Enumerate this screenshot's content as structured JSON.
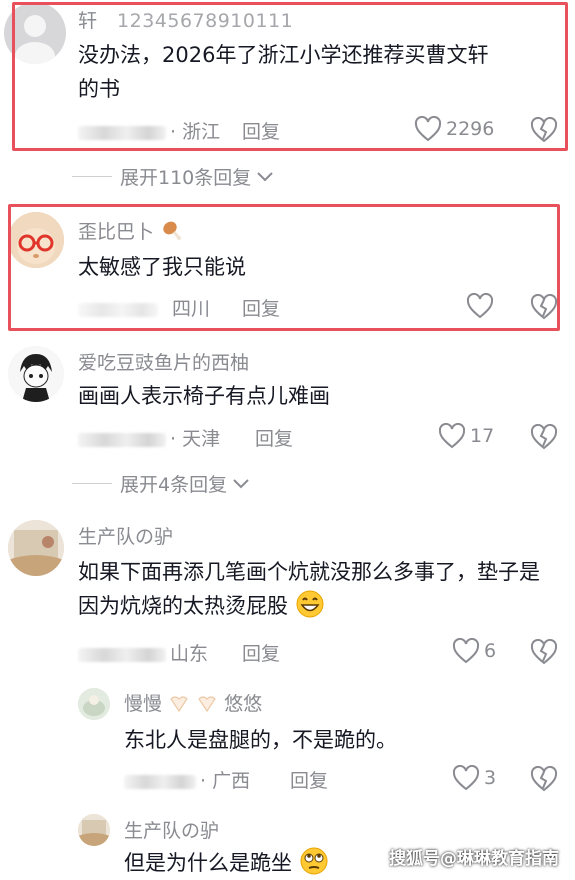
{
  "comments": [
    {
      "username": "轩",
      "user_id": "12345678910111",
      "text": "没办法，2026年了浙江小学还推荐买曹文轩的书",
      "location": "· 浙江",
      "reply_label": "回复",
      "likes": "2296"
    },
    {
      "username": "歪比巴卜",
      "text": "太敏感了我只能说",
      "location": "四川",
      "reply_label": "回复",
      "likes": ""
    },
    {
      "username": "爱吃豆豉鱼片的西柚",
      "text": "画画人表示椅子有点儿难画",
      "location": "· 天津",
      "reply_label": "回复",
      "likes": "17"
    },
    {
      "username": "生产队の驴",
      "text": "如果下面再添几笔画个炕就没那么多事了，垫子是因为炕烧的太热烫屁股",
      "location": "山东",
      "reply_label": "回复",
      "likes": "6"
    }
  ],
  "replies": [
    {
      "username_a": "慢慢",
      "username_b": "悠悠",
      "text": "东北人是盘腿的，不是跪的。",
      "location": "· 广西",
      "reply_label": "回复",
      "likes": "3"
    },
    {
      "username": "生产队の驴",
      "text": "但是为什么是跪坐"
    }
  ],
  "expand_1": "展开110条回复",
  "expand_2": "展开4条回复",
  "watermark": "搜狐号@琳琳教育指南",
  "colors": {
    "highlight_border": "#e8505b",
    "meta_text": "#8a8b91",
    "body_text": "#161823"
  },
  "icons": [
    "heart-icon",
    "dislike-heart-icon",
    "chevron-down-icon",
    "drumstick-icon",
    "grin-emoji",
    "eye-roll-emoji",
    "angel-icon"
  ]
}
